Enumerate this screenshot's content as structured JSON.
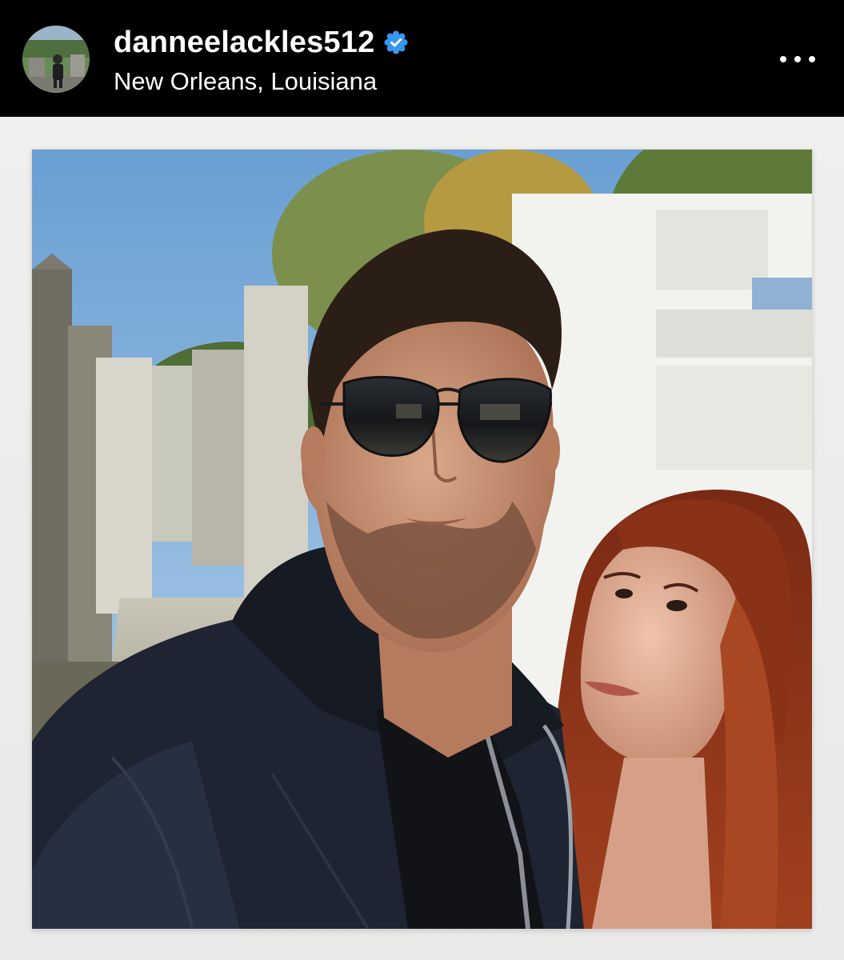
{
  "post": {
    "username": "danneelackles512",
    "location": "New Orleans, Louisiana",
    "verified": true
  },
  "icons": {
    "verified": "verified-badge-icon",
    "more": "more-options-icon"
  },
  "colors": {
    "header_bg": "#000000",
    "verified_blue": "#3897f0",
    "frame_bg": "#ececec"
  }
}
